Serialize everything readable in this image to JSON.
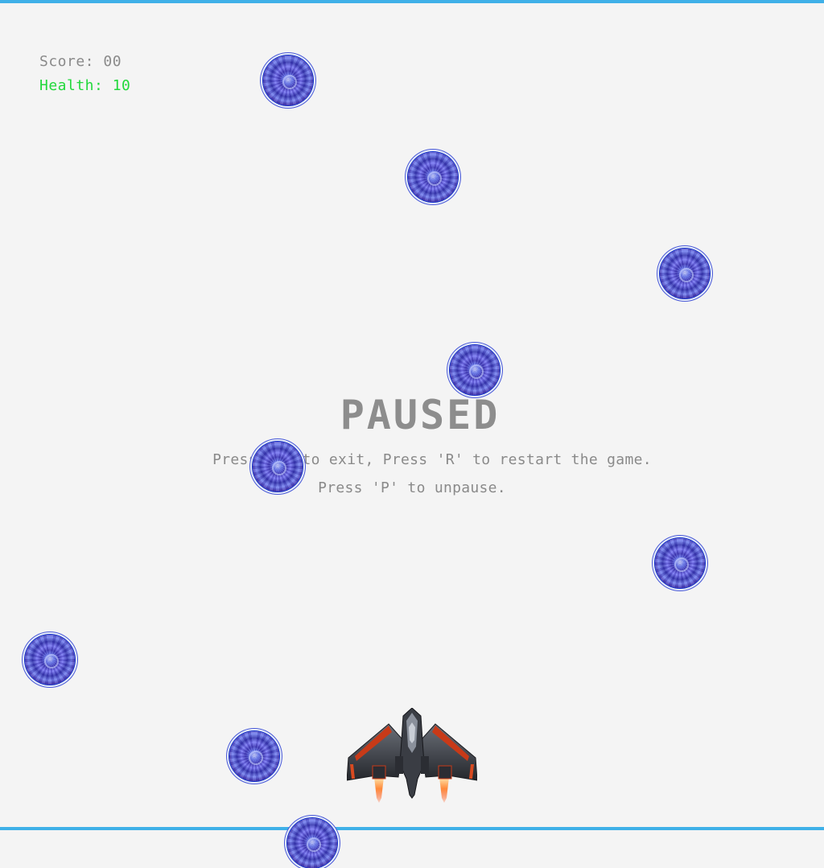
{
  "hud": {
    "score_text": "Score: 00",
    "health_text": "Health: 10"
  },
  "pause_menu": {
    "title": "PAUSED",
    "line1": "Press 'X' to exit, Press 'R' to restart the game.",
    "line2": "Press 'P' to unpause."
  },
  "sprites": {
    "enemy_icon": "blue-orb-mine-icon",
    "player_icon": "spaceship-icon"
  },
  "colors": {
    "frame": "#3fb0e8",
    "score": "#8a8a8a",
    "health": "#22d83c",
    "background": "#f4f4f4"
  }
}
